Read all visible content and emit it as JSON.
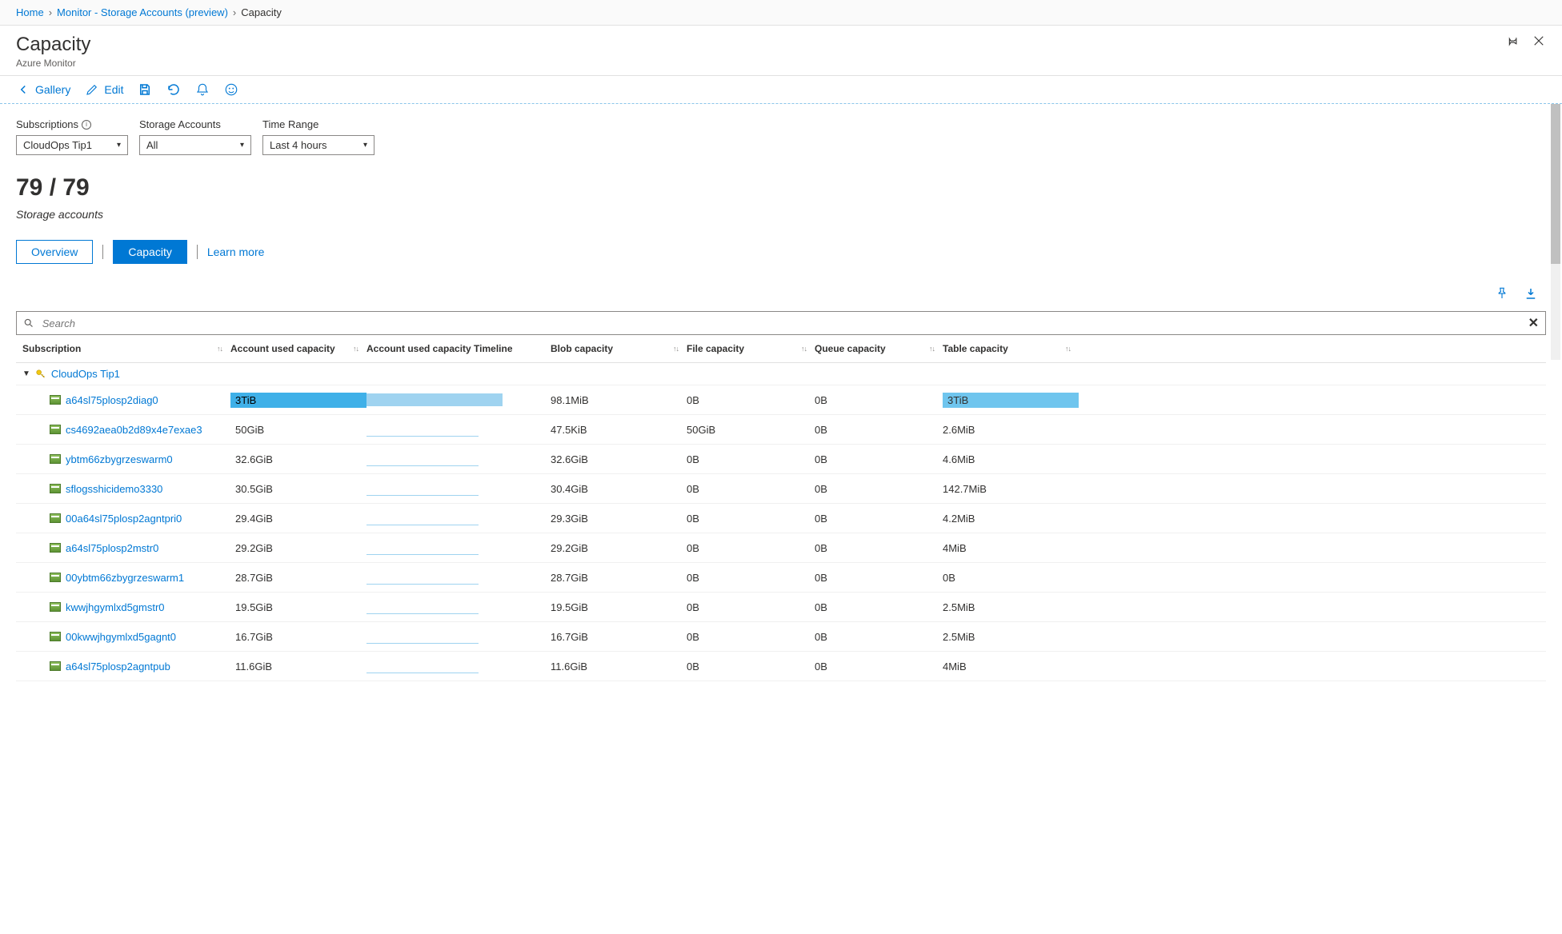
{
  "breadcrumb": {
    "home": "Home",
    "monitor": "Monitor - Storage Accounts (preview)",
    "current": "Capacity"
  },
  "header": {
    "title": "Capacity",
    "subtitle": "Azure Monitor"
  },
  "toolbar": {
    "gallery": "Gallery",
    "edit": "Edit"
  },
  "filters": {
    "subscriptions_label": "Subscriptions",
    "subscriptions_value": "CloudOps Tip1",
    "storage_label": "Storage Accounts",
    "storage_value": "All",
    "time_label": "Time Range",
    "time_value": "Last 4 hours"
  },
  "summary": {
    "count": "79 / 79",
    "label": "Storage accounts"
  },
  "tabs": {
    "overview": "Overview",
    "capacity": "Capacity",
    "learn": "Learn more"
  },
  "search": {
    "placeholder": "Search"
  },
  "columns": {
    "subscription": "Subscription",
    "account_used": "Account used capacity",
    "timeline": "Account used capacity Timeline",
    "blob": "Blob capacity",
    "file": "File capacity",
    "queue": "Queue capacity",
    "table": "Table capacity"
  },
  "group": {
    "name": "CloudOps Tip1"
  },
  "rows": [
    {
      "name": "a64sl75plosp2diag0",
      "account_used": "3TiB",
      "hl": true,
      "tl_w": 170,
      "tl_full": true,
      "blob": "98.1MiB",
      "file": "0B",
      "queue": "0B",
      "table": "3TiB",
      "table_hl": true
    },
    {
      "name": "cs4692aea0b2d89x4e7exae3",
      "account_used": "50GiB",
      "tl_w": 140,
      "blob": "47.5KiB",
      "file": "50GiB",
      "queue": "0B",
      "table": "2.6MiB"
    },
    {
      "name": "ybtm66zbygrzeswarm0",
      "account_used": "32.6GiB",
      "tl_w": 140,
      "blob": "32.6GiB",
      "file": "0B",
      "queue": "0B",
      "table": "4.6MiB"
    },
    {
      "name": "sflogsshicidemo3330",
      "account_used": "30.5GiB",
      "tl_w": 140,
      "blob": "30.4GiB",
      "file": "0B",
      "queue": "0B",
      "table": "142.7MiB"
    },
    {
      "name": "00a64sl75plosp2agntpri0",
      "account_used": "29.4GiB",
      "tl_w": 140,
      "blob": "29.3GiB",
      "file": "0B",
      "queue": "0B",
      "table": "4.2MiB"
    },
    {
      "name": "a64sl75plosp2mstr0",
      "account_used": "29.2GiB",
      "tl_w": 140,
      "blob": "29.2GiB",
      "file": "0B",
      "queue": "0B",
      "table": "4MiB"
    },
    {
      "name": "00ybtm66zbygrzeswarm1",
      "account_used": "28.7GiB",
      "tl_w": 140,
      "blob": "28.7GiB",
      "file": "0B",
      "queue": "0B",
      "table": "0B"
    },
    {
      "name": "kwwjhgymlxd5gmstr0",
      "account_used": "19.5GiB",
      "tl_w": 140,
      "blob": "19.5GiB",
      "file": "0B",
      "queue": "0B",
      "table": "2.5MiB"
    },
    {
      "name": "00kwwjhgymlxd5gagnt0",
      "account_used": "16.7GiB",
      "tl_w": 140,
      "blob": "16.7GiB",
      "file": "0B",
      "queue": "0B",
      "table": "2.5MiB"
    },
    {
      "name": "a64sl75plosp2agntpub",
      "account_used": "11.6GiB",
      "tl_w": 140,
      "blob": "11.6GiB",
      "file": "0B",
      "queue": "0B",
      "table": "4MiB"
    }
  ]
}
